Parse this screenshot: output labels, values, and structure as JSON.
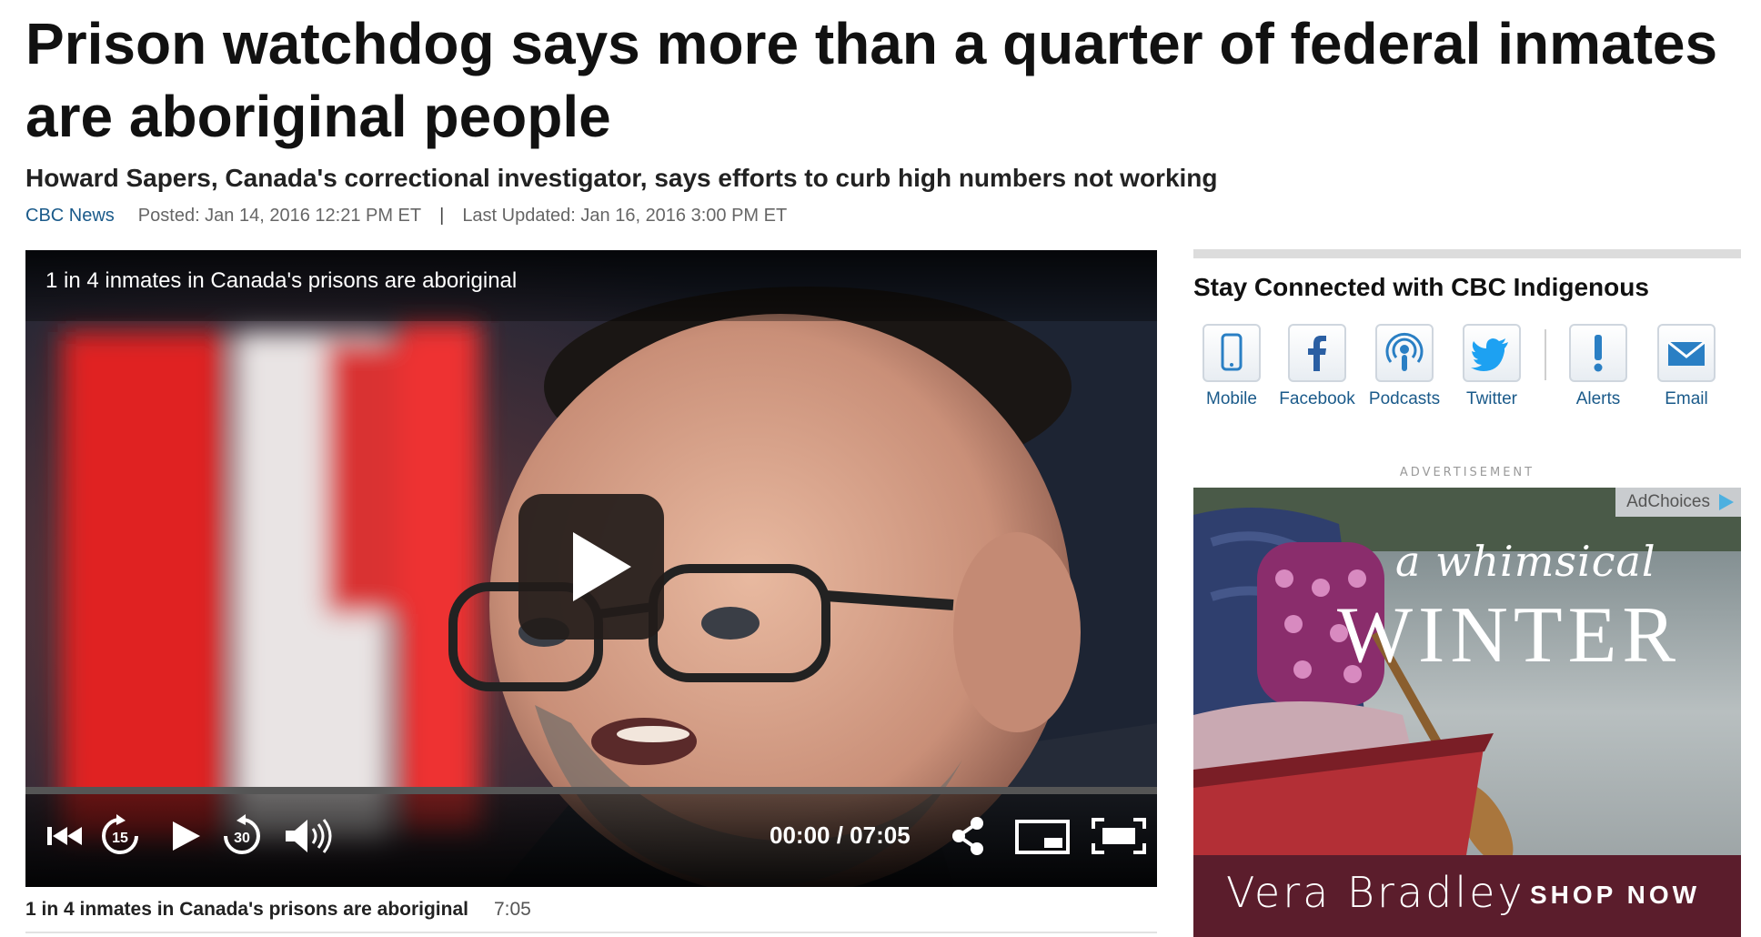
{
  "article": {
    "headline": "Prison watchdog says more than a quarter of federal inmates are aboriginal people",
    "subhead": "Howard Sapers, Canada's correctional investigator, says efforts to curb high numbers not working",
    "source": "CBC News",
    "posted": "Posted: Jan 14, 2016 12:21 PM ET",
    "separator": "|",
    "updated": "Last Updated: Jan 16, 2016 3:00 PM ET"
  },
  "video": {
    "title": "1 in 4 inmates in Canada's prisons are aboriginal",
    "time_display": "00:00 / 07:05",
    "progress": 0,
    "skip_back_seconds": "15",
    "skip_forward_seconds": "30",
    "caption": "1 in 4 inmates in Canada's prisons are aboriginal",
    "duration": "7:05"
  },
  "sidebar": {
    "stay_connected_title": "Stay Connected with CBC Indigenous",
    "social": [
      {
        "label": "Mobile",
        "icon": "mobile-icon"
      },
      {
        "label": "Facebook",
        "icon": "facebook-icon"
      },
      {
        "label": "Podcasts",
        "icon": "podcast-icon"
      },
      {
        "label": "Twitter",
        "icon": "twitter-icon"
      },
      {
        "label": "Alerts",
        "icon": "alert-icon"
      },
      {
        "label": "Email",
        "icon": "email-icon"
      }
    ],
    "ad_label": "ADVERTISEMENT",
    "ad": {
      "adchoices": "AdChoices",
      "line1": "a whimsical",
      "line2": "WINTER",
      "brand": "Vera Bradley",
      "cta": "SHOP NOW"
    }
  },
  "colors": {
    "link": "#1a5a8a",
    "ad_band": "#5b1d2c",
    "twitter": "#1da1f2",
    "facebook": "#2b5fa3"
  }
}
